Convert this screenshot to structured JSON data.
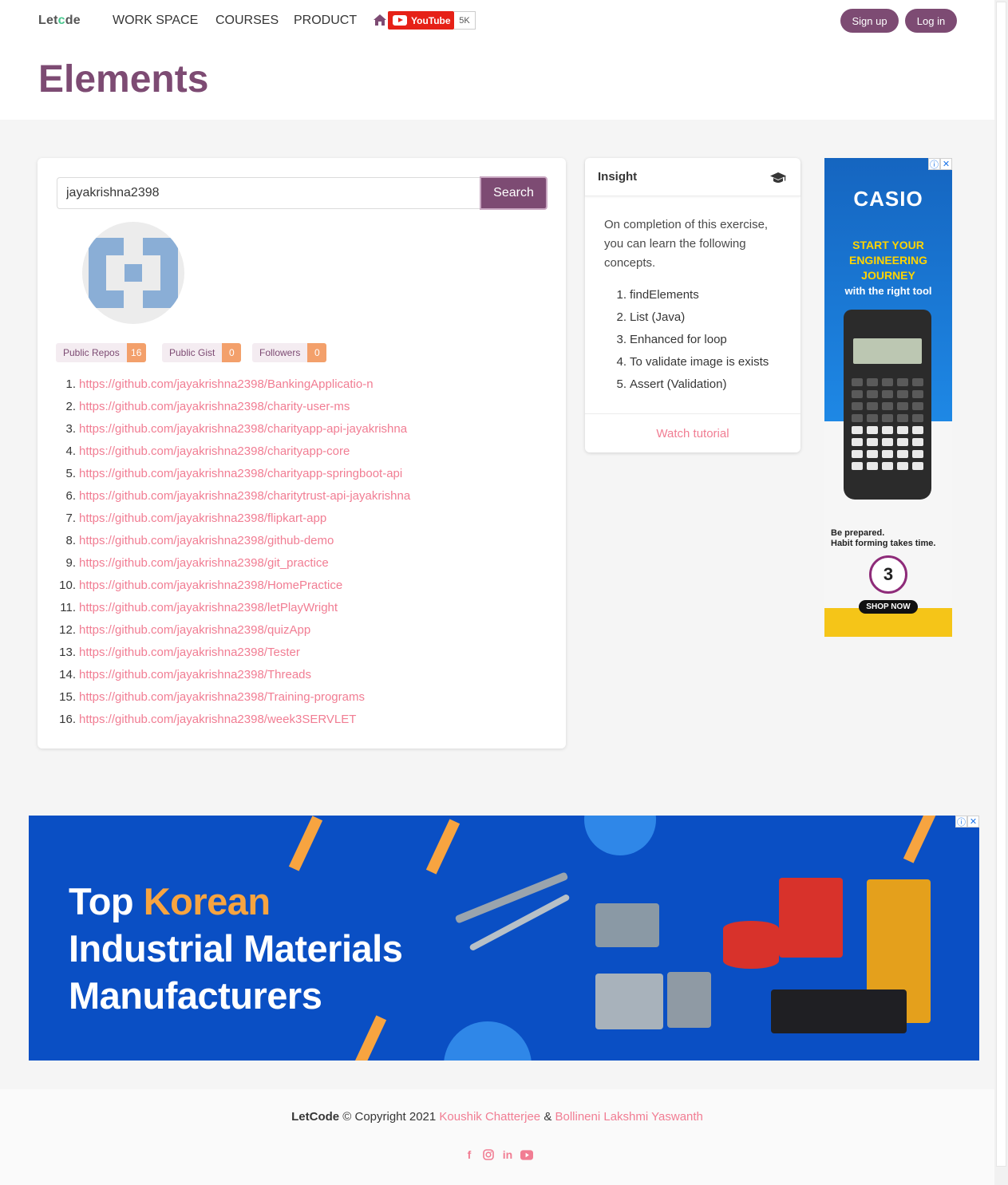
{
  "nav": {
    "logo_pre": "Let",
    "logo_c": "c",
    "logo_post": "de",
    "items": [
      "WORK SPACE",
      "COURSES",
      "PRODUCT"
    ],
    "youtube_label": "YouTube",
    "youtube_count": "5K",
    "signup": "Sign up",
    "login": "Log in"
  },
  "hero": {
    "title": "Elements"
  },
  "search": {
    "value": "jayakrishna2398",
    "button": "Search"
  },
  "stats": [
    {
      "label": "Public Repos",
      "count": "16"
    },
    {
      "label": "Public Gist",
      "count": "0"
    },
    {
      "label": "Followers",
      "count": "0"
    }
  ],
  "repos": [
    "https://github.com/jayakrishna2398/BankingApplicatio-n",
    "https://github.com/jayakrishna2398/charity-user-ms",
    "https://github.com/jayakrishna2398/charityapp-api-jayakrishna",
    "https://github.com/jayakrishna2398/charityapp-core",
    "https://github.com/jayakrishna2398/charityapp-springboot-api",
    "https://github.com/jayakrishna2398/charitytrust-api-jayakrishna",
    "https://github.com/jayakrishna2398/flipkart-app",
    "https://github.com/jayakrishna2398/github-demo",
    "https://github.com/jayakrishna2398/git_practice",
    "https://github.com/jayakrishna2398/HomePractice",
    "https://github.com/jayakrishna2398/letPlayWright",
    "https://github.com/jayakrishna2398/quizApp",
    "https://github.com/jayakrishna2398/Tester",
    "https://github.com/jayakrishna2398/Threads",
    "https://github.com/jayakrishna2398/Training-programs",
    "https://github.com/jayakrishna2398/week3SERVLET"
  ],
  "insight": {
    "title": "Insight",
    "intro": "On completion of this exercise, you can learn the following concepts.",
    "concepts": [
      "findElements",
      "List (Java)",
      "Enhanced for loop",
      "To validate image is exists",
      "Assert (Validation)"
    ],
    "footer_link": "Watch tutorial"
  },
  "side_ad": {
    "brand": "CASIO",
    "line1": "START YOUR",
    "line2": "ENGINEERING JOURNEY",
    "line3": "with the right tool",
    "copy1": "Be prepared.",
    "copy2": "Habit forming takes time.",
    "badge": "3",
    "cta": "SHOP NOW"
  },
  "banner_ad": {
    "word1": "Top",
    "word2": "Korean",
    "line2": "Industrial Materials",
    "line3": "Manufacturers"
  },
  "footer": {
    "brand": "LetCode",
    "copyright": " © Copyright 2021 ",
    "author1": "Koushik Chatterjee",
    "amp": " & ",
    "author2": "Bollineni Lakshmi Yaswanth",
    "social": [
      "facebook-icon",
      "instagram-icon",
      "linkedin-icon",
      "youtube-icon"
    ]
  },
  "colors": {
    "brand": "#7d4b73",
    "link": "#f17d93",
    "badge": "#f3a06b"
  }
}
